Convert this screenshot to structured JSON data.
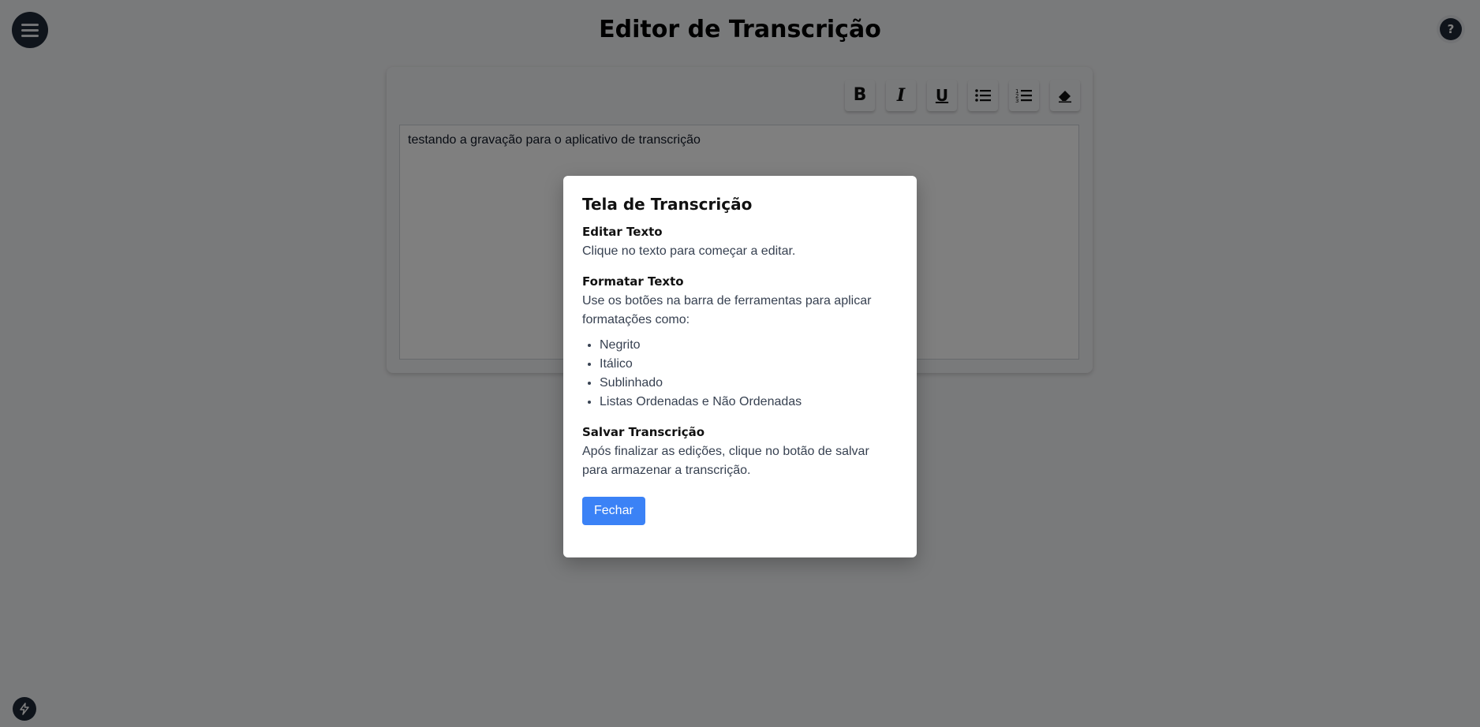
{
  "header": {
    "title": "Editor de Transcrição",
    "menu_icon": "hamburger-menu-icon",
    "help_label": "?"
  },
  "toolbar": {
    "bold": "B",
    "italic": "I",
    "underline": "U",
    "bullet_list_icon": "bullet-list-icon",
    "numbered_list_icon": "numbered-list-icon",
    "clear_format_icon": "eraser-icon"
  },
  "editor": {
    "content": "testando a gravação para o aplicativo de transcrição"
  },
  "modal": {
    "title": "Tela de Transcrição",
    "sections": [
      {
        "heading": "Editar Texto",
        "text": "Clique no texto para começar a editar."
      },
      {
        "heading": "Formatar Texto",
        "text": "Use os botões na barra de ferramentas para aplicar formatações como:",
        "items": [
          "Negrito",
          "Itálico",
          "Sublinhado",
          "Listas Ordenadas e Não Ordenadas"
        ]
      },
      {
        "heading": "Salvar Transcrição",
        "text": "Após finalizar as edições, clique no botão de salvar para armazenar a transcrição."
      }
    ],
    "close_label": "Fechar"
  },
  "colors": {
    "overlay": "rgba(0,0,0,0.5)",
    "primary_button": "#3b82f6",
    "dark_button": "#1f2937"
  }
}
